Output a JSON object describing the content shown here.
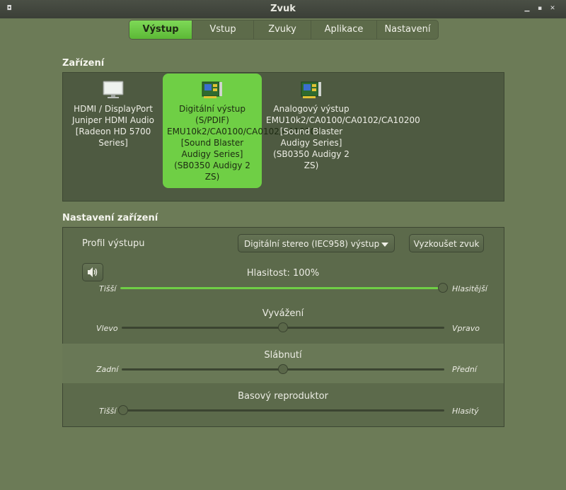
{
  "window": {
    "title": "Zvuk"
  },
  "tabs": [
    {
      "label": "Výstup",
      "active": true
    },
    {
      "label": "Vstup",
      "active": false
    },
    {
      "label": "Zvuky",
      "active": false
    },
    {
      "label": "Aplikace",
      "active": false
    },
    {
      "label": "Nastavení",
      "active": false
    }
  ],
  "devices_section": {
    "title": "Zařízení"
  },
  "devices": [
    {
      "label": "HDMI / DisplayPort Juniper HDMI Audio [Radeon HD 5700 Series]",
      "icon": "monitor-icon",
      "selected": false
    },
    {
      "label": "Digitální výstup (S/PDIF) EMU10k2/CA0100/CA0102/CA10200 [Sound Blaster Audigy Series] (SB0350 Audigy 2 ZS)",
      "icon": "sound-card-icon",
      "selected": true
    },
    {
      "label": "Analogový výstup EMU10k2/CA0100/CA0102/CA10200 [Sound Blaster Audigy Series] (SB0350 Audigy 2 ZS)",
      "icon": "sound-card-icon",
      "selected": false
    }
  ],
  "settings_section": {
    "title": "Nastavení zařízení"
  },
  "profile": {
    "label": "Profil výstupu",
    "value": "Digitální stereo (IEC958) výstup",
    "test_button": "Vyzkoušet zvuk"
  },
  "volume": {
    "title": "Hlasitost: 100%",
    "min_label": "Tišší",
    "max_label": "Hlasitější",
    "value_percent": 100
  },
  "balance": {
    "title": "Vyvážení",
    "min_label": "Vlevo",
    "max_label": "Vpravo",
    "value_fraction": 0.5
  },
  "fade": {
    "title": "Slábnutí",
    "min_label": "Zadní",
    "max_label": "Přední",
    "value_fraction": 0.5
  },
  "subwoofer": {
    "title": "Basový reproduktor",
    "min_label": "Tišší",
    "max_label": "Hlasitý",
    "value_fraction": 0.0
  },
  "colors": {
    "accent": "#6fcf45",
    "background": "#6c7b57",
    "panel": "#4e5a41"
  }
}
